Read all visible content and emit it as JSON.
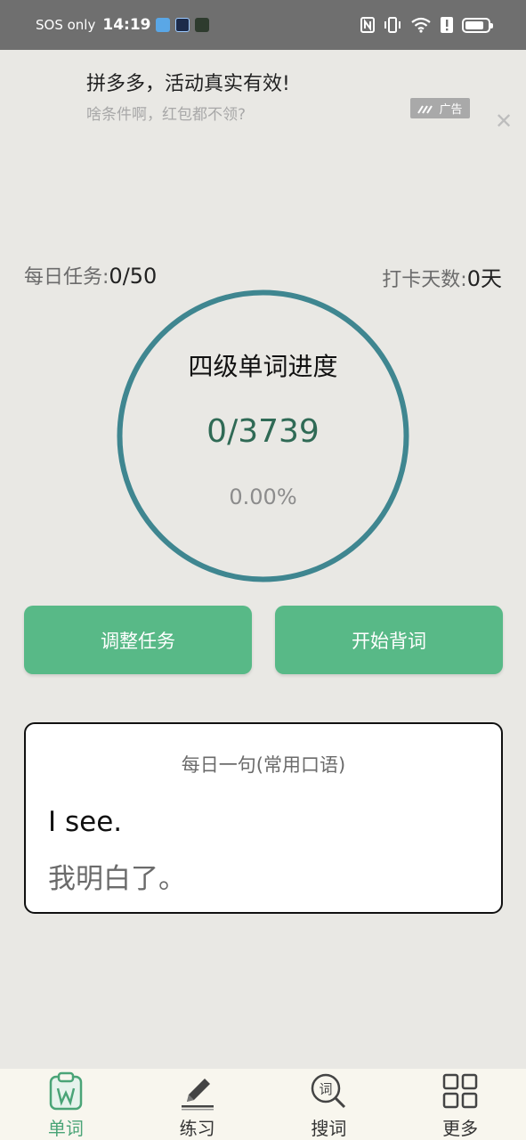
{
  "status_bar": {
    "carrier": "SOS only",
    "time": "14:19",
    "battery_level": 0.85
  },
  "ad": {
    "title": "拼多多，活动真实有效!",
    "subtitle": "啥条件啊，红包都不领?",
    "badge": "广告",
    "close": "✕"
  },
  "stats": {
    "daily_label": "每日任务: ",
    "daily_value": "0/50",
    "checkin_label": "打卡天数: ",
    "checkin_value": "0天"
  },
  "progress": {
    "title": "四级单词进度",
    "count": "0/3739",
    "percent": "0.00%",
    "fraction": 0,
    "ring_color": "#3f8690"
  },
  "buttons": {
    "adjust": "调整任务",
    "start": "开始背词"
  },
  "daily_sentence": {
    "header": "每日一句(常用口语)",
    "english": "I see.",
    "chinese": "我明白了。"
  },
  "bottom_nav": {
    "items": [
      {
        "label": "单词",
        "icon": "word-book-icon",
        "active": true
      },
      {
        "label": "练习",
        "icon": "pencil-icon",
        "active": false
      },
      {
        "label": "搜词",
        "icon": "search-word-icon",
        "active": false
      },
      {
        "label": "更多",
        "icon": "grid-icon",
        "active": false
      }
    ]
  },
  "colors": {
    "accent": "#58b987",
    "nav_active": "#4aa477",
    "background": "#e9e8e4"
  }
}
